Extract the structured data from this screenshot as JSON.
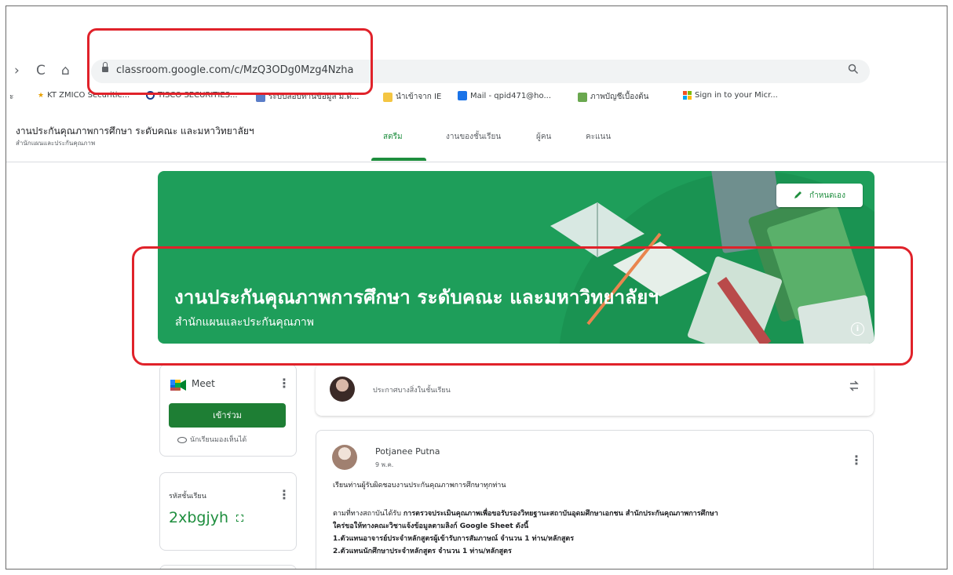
{
  "browser": {
    "url": "classroom.google.com/c/MzQ3ODg0Mzg4Nzha",
    "nav": {
      "forward": "›",
      "reload": "C",
      "home": "⌂",
      "search": "🔍"
    },
    "bookmarks": [
      {
        "label": "KT ZMICO Securitie...",
        "icon": "star-bookmark-icon",
        "color": "#e8a000"
      },
      {
        "label": "TISCO SECURITIES...",
        "icon": "tisco-logo-icon",
        "color": "#1a3c8c"
      },
      {
        "label": "ระบบสอบทานข้อมูล ม.ด้...",
        "icon": "site-icon",
        "color": "#5b7dc8"
      },
      {
        "label": "นำเข้าจาก IE",
        "icon": "folder-icon",
        "color": "#f4c542"
      },
      {
        "label": "Mail - qpid471@ho...",
        "icon": "outlook-icon",
        "color": "#1a73e8"
      },
      {
        "label": "ภาพบัญชีเบื้องต้น",
        "icon": "app-icon",
        "color": "#6aa84f"
      },
      {
        "label": "Sign in to your Micr...",
        "icon": "microsoft-icon",
        "color": "#f25022"
      }
    ]
  },
  "classroom": {
    "title": "งานประกันคุณภาพการศึกษา ระดับคณะ และมหาวิทยาลัยฯ",
    "subtitle": "สำนักแผนและประกันคุณภาพ",
    "tabs": [
      {
        "label": "สตรีม",
        "active": true
      },
      {
        "label": "งานของชั้นเรียน",
        "active": false
      },
      {
        "label": "ผู้คน",
        "active": false
      },
      {
        "label": "คะแนน",
        "active": false
      }
    ]
  },
  "banner": {
    "title": "งานประกันคุณภาพการศึกษา ระดับคณะ และมหาวิทยาลัยฯ",
    "subtitle": "สำนักแผนและประกันคุณภาพ",
    "customize_label": "กำหนดเอง",
    "info": "i",
    "color": "#1e9e5a"
  },
  "meet": {
    "label": "Meet",
    "join_label": "เข้าร่วม",
    "visible_note": "นักเรียนมองเห็นได้"
  },
  "class_code": {
    "label": "รหัสชั้นเรียน",
    "value": "2xbgjyh"
  },
  "announce": {
    "placeholder": "ประกาศบางสิ่งในชั้นเรียน"
  },
  "post": {
    "author": "Potjanee Putna",
    "date": "9 พ.ค.",
    "lines": [
      "เรียนท่านผู้รับผิดชอบงานประกันคุณภาพการศึกษาทุกท่าน",
      "",
      "ตามที่ทางสถาบันได้รับ",
      "การตรวจประเมินคุณภาพเพื่อขอรับรองวิทยฐานะสถาบันอุดมศึกษาเอกชน สำนักประกันคุณภาพการศึกษา",
      "ใคร่ขอให้ทางคณะวิชาแจ้งข้อมูลตามลิงก์ Google Sheet ดังนี้",
      "1.ตัวแทนอาจารย์ประจำหลักสูตรผู้เข้ารับการสัมภาษณ์ จำนวน 1 ท่าน/หลักสูตร",
      "2.ตัวแทนนักศึกษาประจำหลักสูตร จำนวน 1 ท่าน/หลักสูตร"
    ]
  },
  "colors": {
    "accent": "#1e8e3e",
    "join_button": "#1e7e34",
    "highlight": "#e0222a"
  }
}
